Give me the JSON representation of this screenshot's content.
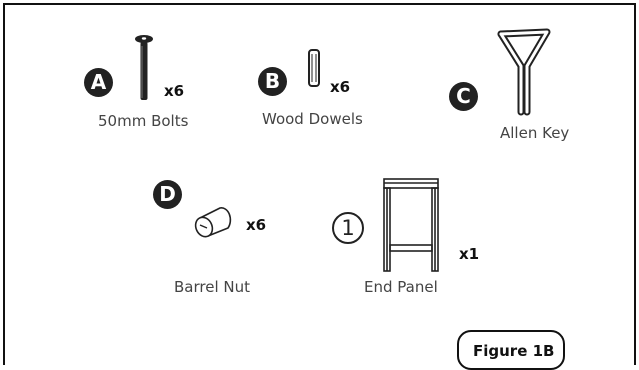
{
  "parts": [
    {
      "badge": "A",
      "qty": "x6",
      "label": "50mm Bolts",
      "icon": "bolt-icon"
    },
    {
      "badge": "B",
      "qty": "x6",
      "label": "Wood Dowels",
      "icon": "dowel-icon"
    },
    {
      "badge": "C",
      "qty": "",
      "label": "Allen Key",
      "icon": "allen-key-icon"
    },
    {
      "badge": "D",
      "qty": "x6",
      "label": "Barrel Nut",
      "icon": "barrel-nut-icon"
    },
    {
      "badge": "1",
      "qty": "x1",
      "label": "End Panel",
      "icon": "end-panel-icon"
    }
  ],
  "figure_tag": "Figure 1B",
  "colors": {
    "ink": "#222222",
    "text": "#444444",
    "outline": "#111111"
  }
}
